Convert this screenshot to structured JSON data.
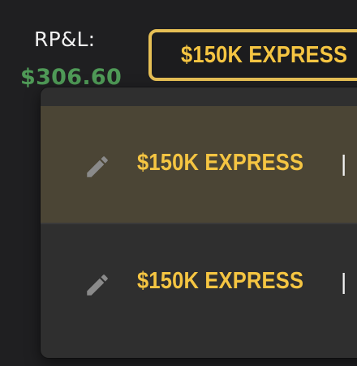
{
  "pnl": {
    "label": "RP&L:",
    "value": "$306.60",
    "value_color": "#4f9a57"
  },
  "account_selector": {
    "selected_label": "$150K EXPRESS",
    "border_color": "#e6bf55",
    "text_color": "#f5c542"
  },
  "dropdown": {
    "items": [
      {
        "label": "$150K EXPRESS",
        "separator": "|",
        "icon": "pencil-icon",
        "selected": true
      },
      {
        "label": "$150K EXPRESS",
        "separator": "|",
        "icon": "pencil-icon",
        "selected": false
      }
    ]
  }
}
